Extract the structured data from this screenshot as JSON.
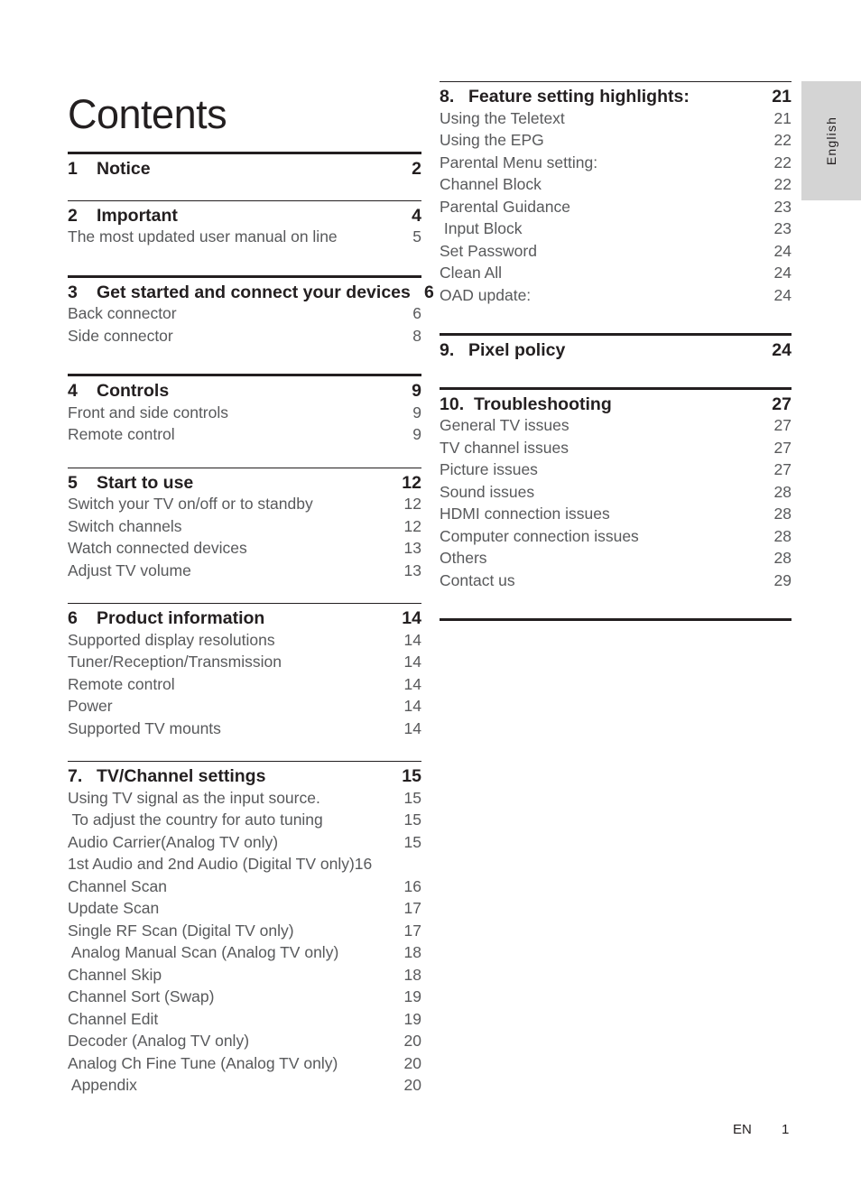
{
  "page_title": "Contents",
  "language_tab": "English",
  "footer": {
    "locale": "EN",
    "page_number": "1"
  },
  "left_column": [
    {
      "rule": "thick",
      "number": "1",
      "title": "Notice",
      "page": "2",
      "tight": false,
      "subitems": []
    },
    {
      "rule": "thin",
      "number": "2",
      "title": "Important",
      "page": "4",
      "tight": false,
      "subitems": [
        {
          "label": "The most updated user manual on line",
          "page": "5"
        }
      ]
    },
    {
      "rule": "thick",
      "number": "3",
      "title": "Get started and connect your devices",
      "page": "6",
      "tight": true,
      "subitems": [
        {
          "label": "Back connector",
          "page": "6"
        },
        {
          "label": "Side connector",
          "page": "8"
        }
      ]
    },
    {
      "rule": "thick",
      "number": "4",
      "title": "Controls",
      "page": "9",
      "tight": false,
      "subitems": [
        {
          "label": "Front and side controls",
          "page": "9"
        },
        {
          "label": "Remote control",
          "page": "9"
        }
      ]
    },
    {
      "rule": "thin",
      "number": "5",
      "title": "Start to use",
      "page": "12",
      "tight": false,
      "subitems": [
        {
          "label": "Switch your TV on/off or to standby",
          "page": "12"
        },
        {
          "label": "Switch channels",
          "page": "12"
        },
        {
          "label": "Watch connected devices",
          "page": "13"
        },
        {
          "label": "Adjust TV volume",
          "page": "13"
        }
      ]
    },
    {
      "rule": "thin",
      "number": "6",
      "title": "Product information",
      "page": "14",
      "tight": false,
      "subitems": [
        {
          "label": "Supported display resolutions",
          "page": "14"
        },
        {
          "label": "Tuner/Reception/Transmission",
          "page": "14"
        },
        {
          "label": "Remote control",
          "page": "14"
        },
        {
          "label": "Power",
          "page": "14"
        },
        {
          "label": "Supported TV mounts",
          "page": "14"
        }
      ]
    },
    {
      "rule": "thin",
      "number": "7.",
      "title": "TV/Channel settings",
      "page": "15",
      "tight": false,
      "subitems": [
        {
          "label": "Using TV signal as the input source.",
          "page": "15"
        },
        {
          "label": " To adjust the country for auto tuning",
          "page": "15"
        },
        {
          "label": "Audio Carrier(Analog TV only)",
          "page": "15"
        },
        {
          "label": "1st Audio and 2nd Audio (Digital TV only)",
          "page": "16",
          "tight": true
        },
        {
          "label": "Channel Scan",
          "page": "16"
        },
        {
          "label": "Update Scan",
          "page": "17"
        },
        {
          "label": "Single RF Scan (Digital TV only)",
          "page": "17"
        },
        {
          "label": " Analog Manual Scan (Analog TV only)",
          "page": "18"
        },
        {
          "label": "Channel Skip",
          "page": "18"
        },
        {
          "label": "Channel Sort (Swap)",
          "page": "19"
        },
        {
          "label": "Channel Edit",
          "page": "19"
        },
        {
          "label": "Decoder (Analog TV only)",
          "page": "20"
        },
        {
          "label": "Analog Ch Fine Tune (Analog TV only)",
          "page": "20"
        },
        {
          "label": " Appendix",
          "page": "20"
        }
      ]
    }
  ],
  "right_column": [
    {
      "rule": "thin",
      "number": "8.",
      "title": "Feature setting highlights:",
      "page": "21",
      "tight": false,
      "subitems": [
        {
          "label": "Using the Teletext",
          "page": "21"
        },
        {
          "label": "Using the EPG",
          "page": "22"
        },
        {
          "label": "Parental Menu setting:",
          "page": "22"
        },
        {
          "label": "Channel Block",
          "page": "22"
        },
        {
          "label": "Parental Guidance",
          "page": "23"
        },
        {
          "label": " Input Block",
          "page": "23"
        },
        {
          "label": "Set Password",
          "page": "24"
        },
        {
          "label": "Clean All",
          "page": "24"
        },
        {
          "label": "OAD update:",
          "page": "24"
        }
      ]
    },
    {
      "rule": "thick",
      "number": "9.",
      "title": "Pixel policy",
      "page": "24",
      "tight": false,
      "subitems": []
    },
    {
      "rule": "thick",
      "number": "10.",
      "title": "Troubleshooting",
      "page": "27",
      "tight": false,
      "wide_number": true,
      "subitems": [
        {
          "label": "General TV issues",
          "page": "27"
        },
        {
          "label": "TV channel issues",
          "page": "27"
        },
        {
          "label": "Picture issues",
          "page": "27"
        },
        {
          "label": "Sound issues",
          "page": "28"
        },
        {
          "label": "HDMI connection issues",
          "page": "28"
        },
        {
          "label": "Computer connection issues",
          "page": "28"
        },
        {
          "label": "Others",
          "page": "28"
        },
        {
          "label": "Contact us",
          "page": "29"
        }
      ]
    }
  ],
  "closing_rule": "thick",
  "colors": {
    "heading": "#231f20",
    "subentry": "#58595b",
    "tab_background": "#d4d4d4"
  }
}
